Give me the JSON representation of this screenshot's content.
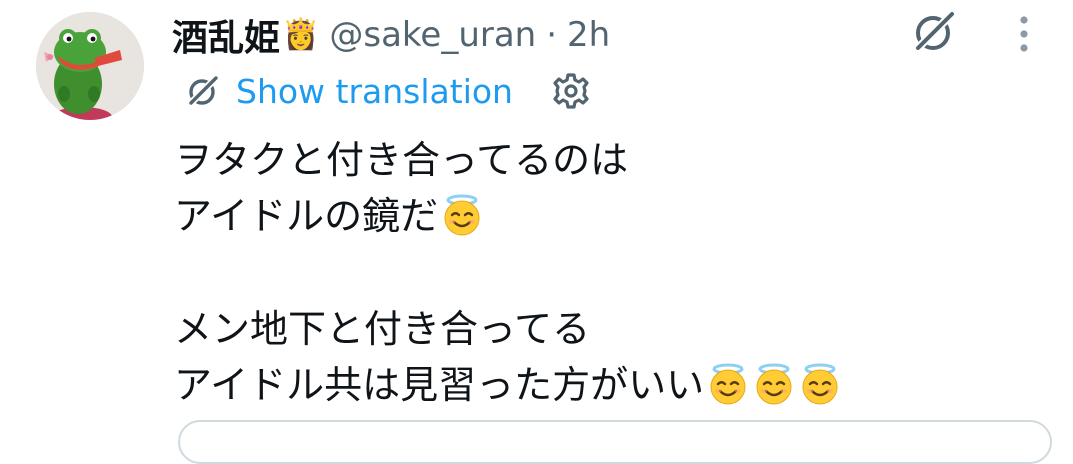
{
  "tweet": {
    "author": {
      "display_name": "酒乱姫",
      "name_emoji": "👸",
      "handle": "@sake_uran",
      "separator": "·",
      "time": "2h",
      "avatar_icon": "frog-plush-avatar"
    },
    "actions": {
      "grok_icon": "grok-icon",
      "more_icon": "more-vertical-icon"
    },
    "translation": {
      "icon": "grok-icon",
      "link_label": "Show translation",
      "settings_icon": "gear-icon",
      "link_color": "#1d9bf0"
    },
    "body": {
      "line1": "ヲタクと付き合ってるのは",
      "line2": "アイドルの鏡だ",
      "line2_emoji": "smiling-face-with-halo",
      "line3": "メン地下と付き合ってる",
      "line4": "アイドル共は見習った方がいい",
      "line4_emoji_count": 3
    },
    "colors": {
      "text": "#0f1419",
      "secondary": "#536471",
      "accent": "#1d9bf0",
      "border": "#cfd9de"
    }
  }
}
